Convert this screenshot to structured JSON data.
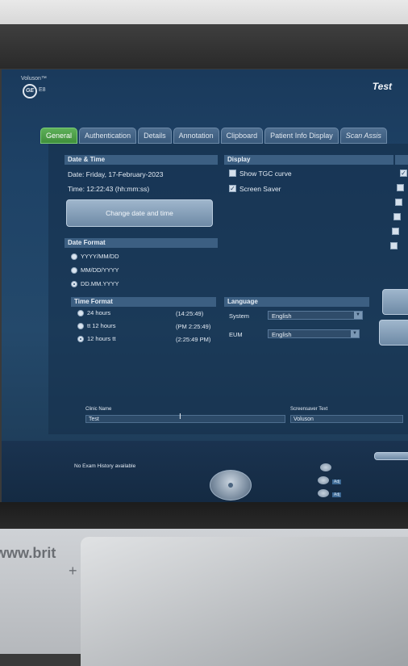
{
  "brand": {
    "product": "Voluson™",
    "logo": "GE",
    "model": "E8"
  },
  "title": "Test",
  "tabs": [
    {
      "label": "General"
    },
    {
      "label": "Authentication"
    },
    {
      "label": "Details"
    },
    {
      "label": "Annotation"
    },
    {
      "label": "Clipboard"
    },
    {
      "label": "Patient Info Display"
    },
    {
      "label": "Scan Assis"
    }
  ],
  "date_time": {
    "heading": "Date & Time",
    "date_line": "Date: Friday, 17-February-2023",
    "time_line": "Time: 12:22:43 (hh:mm:ss)",
    "change_button": "Change date and time"
  },
  "date_format": {
    "heading": "Date Format",
    "options": [
      "YYYY/MM/DD",
      "MM/DD/YYYY",
      "DD.MM.YYYY"
    ],
    "selected": 2
  },
  "time_format": {
    "heading": "Time Format",
    "options": [
      {
        "label": "24 hours",
        "example": "(14:25:49)"
      },
      {
        "label": "tt 12 hours",
        "example": "(PM 2:25:49)"
      },
      {
        "label": "12 hours tt",
        "example": "(2:25:49 PM)"
      }
    ],
    "selected": 2
  },
  "display": {
    "heading": "Display",
    "show_tgc": {
      "label": "Show TGC curve",
      "checked": false
    },
    "screen_saver": {
      "label": "Screen Saver",
      "checked": true
    }
  },
  "language": {
    "heading": "Language",
    "system_label": "System",
    "system_value": "English",
    "eum_label": "EUM",
    "eum_value": "English"
  },
  "clinic": {
    "label": "Clinic Name",
    "value": "Test"
  },
  "screensaver_text": {
    "label": "Screensaver Text",
    "value": "Voluson"
  },
  "status": {
    "exam_history": "No Exam History available"
  },
  "photo": {
    "url_fragment": "www.brit",
    "plus": "+"
  },
  "colors": {
    "active_tab": "#4ea34a",
    "screen_bg": "#1e4266",
    "header_bar": "#3c5f82"
  }
}
